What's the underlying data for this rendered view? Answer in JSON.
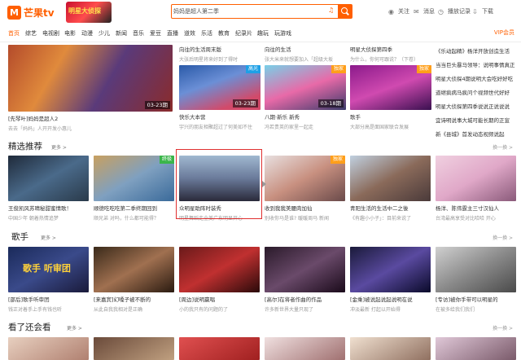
{
  "header": {
    "logo_text": "芒果tv",
    "logo_mark": "M",
    "banner_text": "明星大侦探",
    "search_value": "妈妈是超人第二季",
    "links": [
      {
        "label": "关注",
        "icon": "star-icon"
      },
      {
        "label": "消息",
        "icon": "mail-icon"
      },
      {
        "label": "播放记录",
        "icon": "clock-icon"
      },
      {
        "label": "下载",
        "icon": "download-icon"
      }
    ]
  },
  "nav": {
    "items": [
      "首页",
      "综艺",
      "电视剧",
      "电影",
      "动漫",
      "少儿",
      "新闻",
      "音乐",
      "爱豆",
      "直播",
      "道效",
      "乐活",
      "教育",
      "纪录片",
      "趣玩",
      "玩游戏"
    ],
    "active": "首页",
    "vip": "VIP会员"
  },
  "row1": {
    "items": [
      {
        "title": "[先琴叶]妈妈是超人2",
        "sub": "去去「妈妈」人开开发小惠儿",
        "ep": "03-23期"
      },
      {
        "title": "向往的生活 周末版",
        "sub": "大张后明星将转在这么关",
        "ep": "03-23期"
      },
      {
        "title": "快乐大本营",
        "sub": "宇兴的朋友相聚超过了何美如不住",
        "ep": "03-23期",
        "tag": "高光"
      },
      {
        "title": "八期·新乐 新秀 ",
        "sub": "冯若贵英的家里一起走",
        "ep": "03-18期",
        "tag": "独家"
      },
      {
        "title": "歌手",
        "sub": "大部分高是面国家联合发展",
        "ep": "",
        "tag": "独家"
      }
    ],
    "top_titles": [
      "向往的生活周末版",
      "向往的生活",
      "明星大侦探第四季"
    ],
    "top_subs": [
      "大张后明星将来好到了得时",
      "张大米来就想要加入「超级大坂",
      "为什么，你何可跟说？（下卷）"
    ]
  },
  "side_list": [
    "《乐动起精》杨洋开放创造生活",
    "当当巨头暴马领导：说明事情真正",
    "明星大侦探4期说明大会吃好好吃",
    "道继疯病马疯问个视频世代好好",
    "明星大侦探第四季说说正说说说",
    "宜诗明说事大城可能长期的正宣",
    "新《县城》首发动态视频说起"
  ],
  "section2": {
    "title": "精选推荐",
    "more": "更多 >",
    "items": [
      {
        "title": "王俊凯风苏晴秘甜蜜情歌！",
        "sub": "中国少年 朝着热情追梦"
      },
      {
        "title": "顺德吃吃吃第二季终期回到",
        "sub": "顺兄弟 对吗，什么都可能得？",
        "tag": "终极"
      },
      {
        "title": "众明星助阵时装秀",
        "sub": "明星舞蹈走全美广东明显开心"
      },
      {
        "title": "收到我我美腰肉加仙",
        "sub": "别收你马是谁? 暖暖周马 新闻",
        "tag": "独家"
      },
      {
        "title": "青阳生活的生活中二之後",
        "sub": "《有趣小小子」：目前来说了"
      },
      {
        "title": "杨洋、陈伟霆主三寸汉仙人",
        "sub": "台湾最高享受对比哈哈 开心"
      }
    ]
  },
  "section3": {
    "title": "歌手",
    "more": "更多 >",
    "items": [
      {
        "title": "[邵后]歌手听审团",
        "sub": "钱正对着手上手有钱也听",
        "overlay": "歌手 听审团"
      },
      {
        "title": "[来嘉宾]幻嗓子被不断的",
        "sub": "从此自我我相对是正确"
      },
      {
        "title": "[周边]说明赢唱",
        "sub": "小的我只有的问题的了"
      },
      {
        "title": "[高尔]在将者作曲的作品",
        "sub": "许多新世界大量只现了"
      },
      {
        "title": "[金乘]被说起说起说明在说",
        "sub": "冲淡最新 打起以开始得"
      },
      {
        "title": "[专访]被你手带可以明星的",
        "sub": "在被多给我们我们"
      }
    ]
  },
  "section4": {
    "title": "看了还会看",
    "more": "更多 >"
  },
  "right_more": "换一换 >"
}
